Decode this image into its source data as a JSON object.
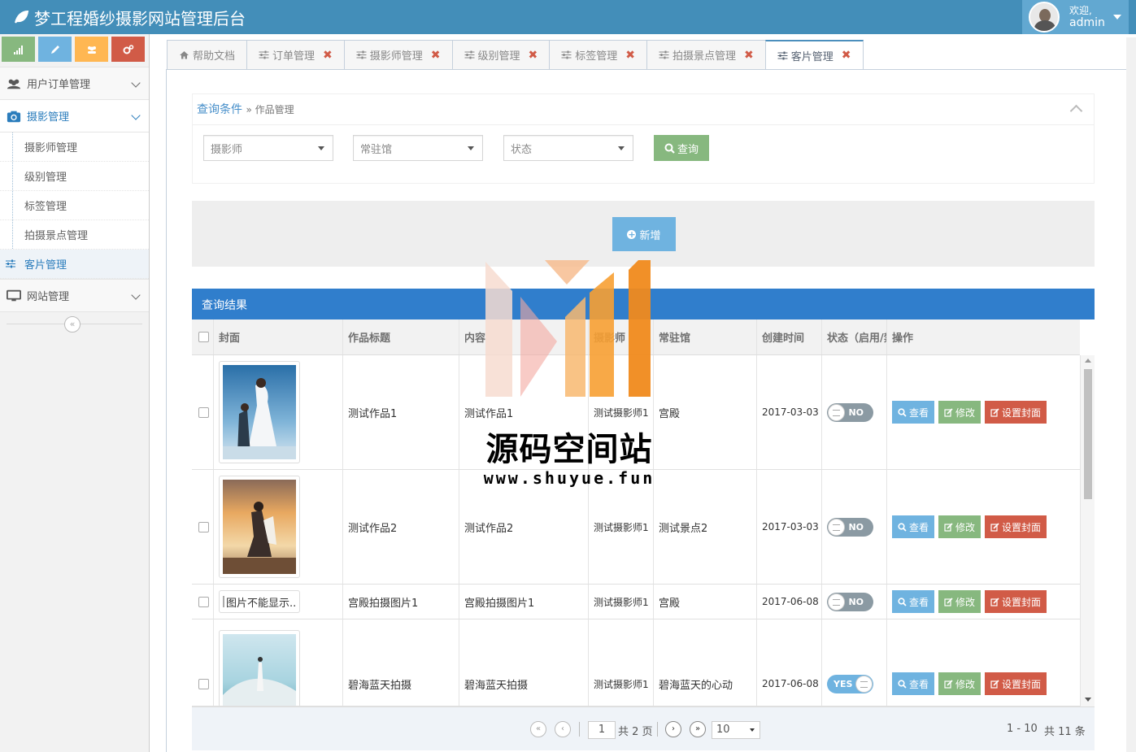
{
  "app": {
    "title": "梦工程婚纱摄影网站管理后台",
    "welcome": "欢迎,",
    "username": "admin"
  },
  "colors": {
    "navbar": "#438eb9",
    "primary": "#307ecc",
    "success": "#87b87f",
    "danger": "#d15b47",
    "info": "#6fb3e0",
    "warning": "#ffb752"
  },
  "shortcuts": [
    {
      "icon": "signal-icon",
      "color": "#87b87f"
    },
    {
      "icon": "pencil-icon",
      "color": "#6fb3e0"
    },
    {
      "icon": "group-icon",
      "color": "#ffb752"
    },
    {
      "icon": "cogs-icon",
      "color": "#d15b47"
    }
  ],
  "sidebar": {
    "menu1": "用户订单管理",
    "menu2": "摄影管理",
    "sub": [
      "摄影师管理",
      "级别管理",
      "标签管理",
      "拍摄景点管理",
      "客片管理"
    ],
    "menu3": "网站管理"
  },
  "tabs": [
    {
      "label": "帮助文档",
      "icon": "home-icon",
      "closable": false
    },
    {
      "label": "订单管理",
      "icon": "sliders-icon",
      "closable": true
    },
    {
      "label": "摄影师管理",
      "icon": "sliders-icon",
      "closable": true
    },
    {
      "label": "级别管理",
      "icon": "sliders-icon",
      "closable": true
    },
    {
      "label": "标签管理",
      "icon": "sliders-icon",
      "closable": true
    },
    {
      "label": "拍摄景点管理",
      "icon": "sliders-icon",
      "closable": true
    },
    {
      "label": "客片管理",
      "icon": "sliders-icon",
      "closable": true,
      "active": true
    }
  ],
  "query": {
    "title": "查询条件",
    "crumb": "» 作品管理",
    "photographer_placeholder": "摄影师",
    "studio_placeholder": "常驻馆",
    "status_placeholder": "状态",
    "search_label": "查询"
  },
  "add_label": "新增",
  "results": {
    "title": "查询结果",
    "columns": [
      "封面",
      "作品标题",
      "内容",
      "摄影师",
      "常驻馆",
      "创建时间",
      "状态（启用/禁用）",
      "操作"
    ],
    "rows": [
      {
        "cover": "wedding-photo-1",
        "title": "测试作品1",
        "content": "测试作品1",
        "photographer": "测试摄影师1",
        "studio": "宫殿",
        "created": "2017-03-03",
        "status": "NO"
      },
      {
        "cover": "wedding-photo-2",
        "title": "测试作品2",
        "content": "测试作品2",
        "photographer": "测试摄影师1",
        "studio": "测试景点2",
        "created": "2017-03-03",
        "status": "NO"
      },
      {
        "cover": "broken",
        "cover_alt": "图片不能显示..",
        "title": "宫殿拍摄图片1",
        "content": "宫殿拍摄图片1",
        "photographer": "测试摄影师1",
        "studio": "宫殿",
        "created": "2017-06-08",
        "status": "NO"
      },
      {
        "cover": "wedding-photo-3",
        "title": "碧海蓝天拍摄",
        "content": "碧海蓝天拍摄",
        "photographer": "测试摄影师1",
        "studio": "碧海蓝天的心动",
        "created": "2017-06-08",
        "status": "YES"
      }
    ],
    "actions": {
      "view": "查看",
      "edit": "修改",
      "cover": "设置封面"
    }
  },
  "pager": {
    "current": "1",
    "total_pages": "共 2 页",
    "page_size": "10",
    "range": "1 - 10",
    "total": "共 11 条"
  },
  "watermark": {
    "title": "源码空间站",
    "url": "www.shuyue.fun"
  }
}
